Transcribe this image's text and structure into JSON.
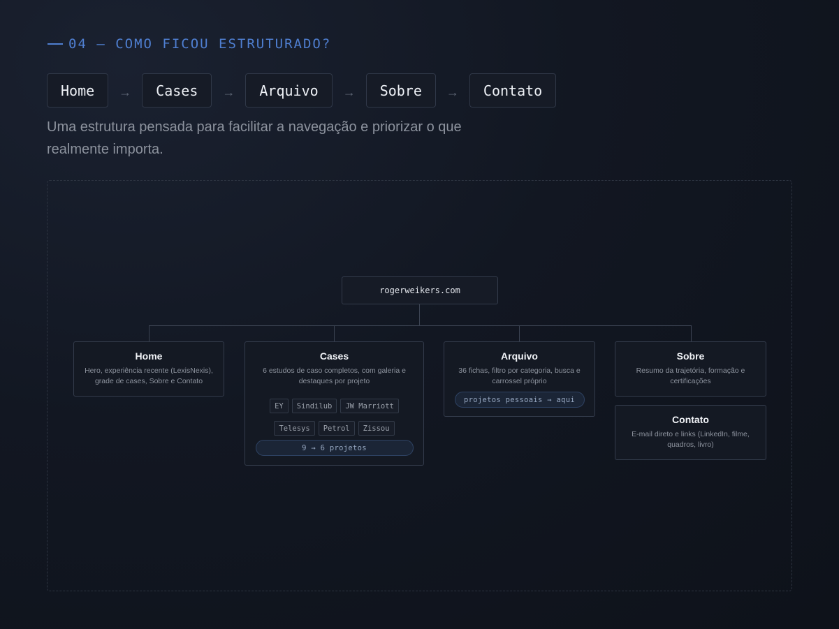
{
  "section": {
    "eyebrow": "04 — COMO FICOU ESTRUTURADO?"
  },
  "nav": {
    "items": [
      "Home",
      "Cases",
      "Arquivo",
      "Sobre",
      "Contato"
    ],
    "arrow": "→"
  },
  "description": "Uma estrutura pensada para facilitar a navegação e priorizar o que realmente importa.",
  "diagram": {
    "root": "rogerweikers.com",
    "home": {
      "title": "Home",
      "desc": "Hero, experiência recente (LexisNexis), grade de cases, Sobre e Contato"
    },
    "cases": {
      "title": "Cases",
      "desc": "6 estudos de caso completos, com galeria e destaques por projeto",
      "tags_row1": [
        "EY",
        "Sindilub",
        "JW Marriott"
      ],
      "tags_row2": [
        "Telesys",
        "Petrol",
        "Zissou"
      ],
      "note": "9 → 6 projetos"
    },
    "arquivo": {
      "title": "Arquivo",
      "desc": "36 fichas, filtro por categoria, busca e carrossel próprio",
      "note": "projetos pessoais → aqui"
    },
    "sobre": {
      "title": "Sobre",
      "desc": "Resumo da trajetória, formação e certificações"
    },
    "contato": {
      "title": "Contato",
      "desc": "E-mail direto e links (LinkedIn, filme, quadros, livro)"
    }
  }
}
